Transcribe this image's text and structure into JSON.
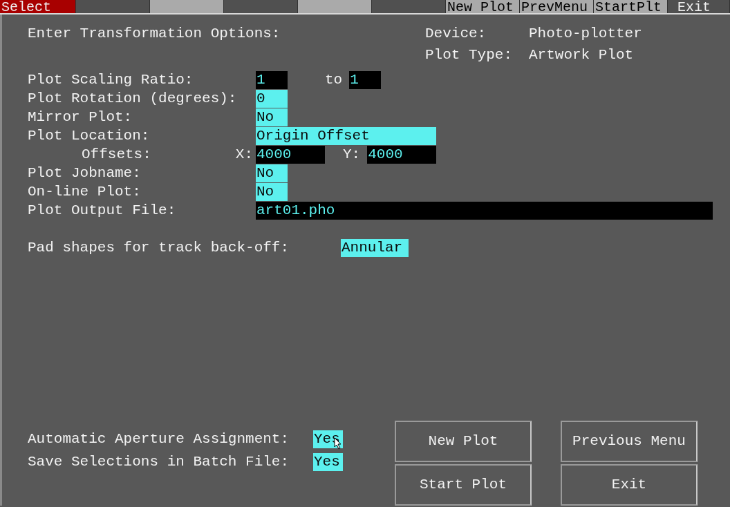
{
  "function_keys": [
    {
      "kind": "title",
      "label": "Select"
    },
    {
      "kind": "blank",
      "highlighted": false
    },
    {
      "kind": "blank",
      "highlighted": true
    },
    {
      "kind": "blank",
      "highlighted": false
    },
    {
      "kind": "blank",
      "highlighted": true
    },
    {
      "kind": "blank",
      "highlighted": false
    },
    {
      "kind": "key",
      "label": "New Plot",
      "highlighted": true
    },
    {
      "kind": "key",
      "label": "PrevMenu",
      "highlighted": true
    },
    {
      "kind": "key",
      "label": "StartPlt",
      "highlighted": true
    },
    {
      "kind": "key",
      "label": "Exit",
      "highlighted": false
    }
  ],
  "heading": "Enter Transformation Options:",
  "info": [
    {
      "label": "Device:",
      "value": "Photo-plotter"
    },
    {
      "label": "Plot Type:",
      "value": "Artwork Plot"
    }
  ],
  "options": [
    {
      "label": "Plot Scaling Ratio:",
      "items": [
        {
          "kind": "entry",
          "text": "1"
        },
        {
          "kind": "label",
          "text": "to"
        },
        {
          "kind": "entry",
          "text": "1"
        }
      ]
    },
    {
      "label": "Plot Rotation (degrees):",
      "items": [
        {
          "kind": "choice",
          "text": "0"
        }
      ]
    },
    {
      "label": "Mirror Plot:",
      "items": [
        {
          "kind": "choice",
          "text": "No"
        }
      ]
    },
    {
      "label": "Plot Location:",
      "items": [
        {
          "kind": "choice",
          "text": "Origin Offset"
        }
      ],
      "children": [
        {
          "label": "Offsets:",
          "lead": "X:",
          "items": [
            {
              "kind": "entry",
              "text": "4000"
            },
            {
              "kind": "label",
              "text": "Y:"
            },
            {
              "kind": "entry",
              "text": "4000"
            }
          ]
        }
      ]
    },
    {
      "label": "Plot Jobname:",
      "items": [
        {
          "kind": "choice",
          "text": "No"
        }
      ]
    },
    {
      "label": "On-line Plot:",
      "items": [
        {
          "kind": "choice",
          "text": "No"
        }
      ]
    },
    {
      "label": "Plot Output File:",
      "items": [
        {
          "kind": "entry",
          "text": "art01.pho"
        }
      ]
    }
  ],
  "pad_shapes": {
    "label": "Pad shapes for track back-off:",
    "value": {
      "kind": "choice",
      "text": "Annular"
    }
  },
  "batch_options": [
    {
      "label": "Automatic Aperture Assignment:",
      "value": {
        "kind": "choice",
        "text": "Yes"
      }
    },
    {
      "label": "Save Selections in Batch File:",
      "value": {
        "kind": "choice",
        "text": "Yes"
      }
    }
  ],
  "buttons": [
    "New Plot",
    "Previous Menu",
    "Start Plot",
    "Exit"
  ]
}
